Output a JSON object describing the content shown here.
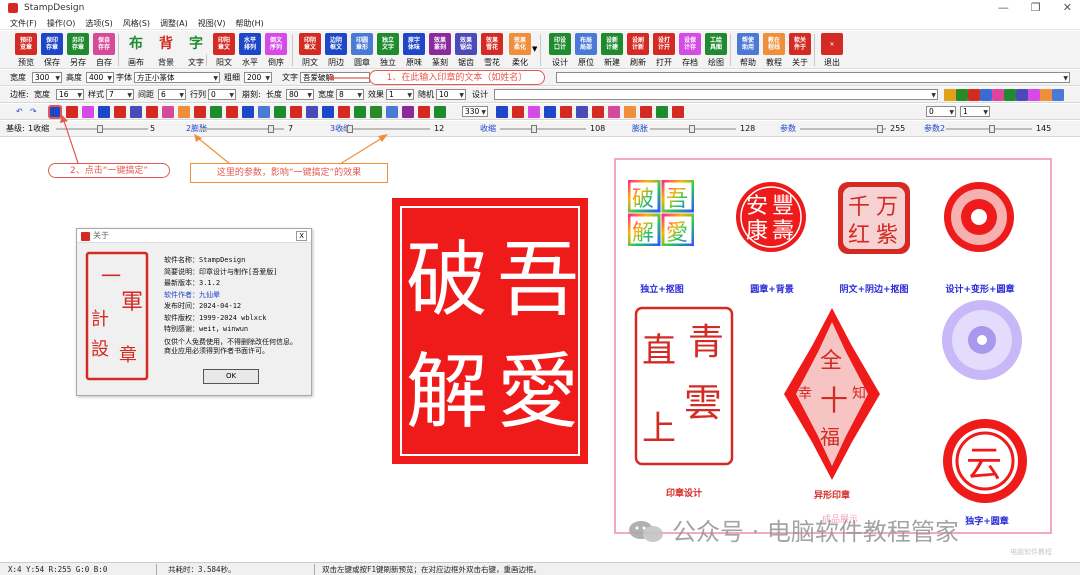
{
  "window": {
    "title": "StampDesign"
  },
  "menu": [
    "文件(F)",
    "操作(O)",
    "选项(S)",
    "风格(S)",
    "调整(A)",
    "视图(V)",
    "帮助(H)"
  ],
  "toolbar": [
    {
      "icon": "预印\n览章",
      "label": "预览",
      "color": "#d42a24"
    },
    {
      "icon": "保印\n存章",
      "label": "保存",
      "color": "#1e46c8"
    },
    {
      "icon": "另印\n存章",
      "label": "另存",
      "color": "#1f8a2e"
    },
    {
      "icon": "保自\n存存",
      "label": "自存",
      "color": "#d64a9c"
    },
    {
      "icon": "布",
      "label": "画布",
      "color": "#f3f3f3"
    },
    {
      "icon": "背",
      "label": "背景",
      "color": "#f3f3f3"
    },
    {
      "icon": "字",
      "label": "文字",
      "color": "#f3f3f3"
    },
    {
      "icon": "印阳\n章文",
      "label": "阳文",
      "color": "#d42a24"
    },
    {
      "icon": "水平\n排列",
      "label": "水平",
      "color": "#1e46c8"
    },
    {
      "icon": "倒文\n序列",
      "label": "倒序",
      "color": "#d64ae8"
    },
    {
      "icon": "印阴\n章文",
      "label": "阴文",
      "color": "#d42a24"
    },
    {
      "icon": "边阴\n框文",
      "label": "阴边",
      "color": "#1e46c8"
    },
    {
      "icon": "印圆\n章形",
      "label": "圆章",
      "color": "#4a7ad6"
    },
    {
      "icon": "独立\n文字",
      "label": "独立",
      "color": "#1f8a2e"
    },
    {
      "icon": "原字\n体味",
      "label": "原味",
      "color": "#1e46c8"
    },
    {
      "icon": "效果\n篆刻",
      "label": "篆刻",
      "color": "#8a2a9c"
    },
    {
      "icon": "效果\n锯齿",
      "label": "锯齿",
      "color": "#4a4ab8"
    },
    {
      "icon": "效果\n雪花",
      "label": "雪花",
      "color": "#d42a24"
    },
    {
      "icon": "效果\n柔化",
      "label": "柔化",
      "color": "#ef8f3c"
    },
    {
      "icon": "印设\n口计",
      "label": "设计",
      "color": "#1f8a2e"
    },
    {
      "icon": "布局\n局部",
      "label": "原位",
      "color": "#4a7ad6"
    },
    {
      "icon": "设新\n计建",
      "label": "新建",
      "color": "#1f8a2e"
    },
    {
      "icon": "设刷\n计新",
      "label": "刷新",
      "color": "#d42a24"
    },
    {
      "icon": "设打\n计开",
      "label": "打开",
      "color": "#d42a24"
    },
    {
      "icon": "设保\n计存",
      "label": "存档",
      "color": "#d64ae8"
    },
    {
      "icon": "工绘\n具图",
      "label": "绘图",
      "color": "#1f8a2e"
    },
    {
      "icon": "帮使\n助用",
      "label": "帮助",
      "color": "#4a7ad6"
    },
    {
      "icon": "教在\n程线",
      "label": "教程",
      "color": "#ef8f3c"
    },
    {
      "icon": "软关\n件于",
      "label": "关于",
      "color": "#d42a24"
    },
    {
      "icon": "✕",
      "label": "退出",
      "color": "#d42a24"
    }
  ],
  "row1": {
    "width_label": "宽度",
    "width_value": "300",
    "height_label": "高度",
    "height_value": "400",
    "font_label": "字体",
    "font_value": "方正小篆体",
    "weight_label": "粗细",
    "weight_value": "200",
    "text_label": "文字",
    "text_value": "吾爱破解"
  },
  "row2": {
    "border_label": "边框:",
    "bw_label": "宽度",
    "bw_value": "16",
    "style_label": "样式",
    "style_value": "7",
    "gap_label": "间距",
    "gap_value": "6",
    "rowspace_label": "行列",
    "rowspace_value": "0",
    "notch_label": "崩刻:",
    "len_label": "长度",
    "len_value": "80",
    "nw_label": "宽度",
    "nw_value": "8",
    "effect_label": "效果",
    "effect_value": "1",
    "rand_label": "随机",
    "rand_value": "10",
    "design_label": "设计"
  },
  "row3": {
    "angle_value": "330",
    "zero1": "0",
    "zero2": "1"
  },
  "row4": [
    {
      "label": "基级:",
      "sub": "1收缩",
      "value": "5"
    },
    {
      "label": "2膨胀",
      "value": "7"
    },
    {
      "label": "3收缩",
      "value": "12"
    },
    {
      "label": "收缩",
      "value": "108"
    },
    {
      "label": "膨胀",
      "value": "128"
    },
    {
      "label": "参数",
      "value": "255"
    },
    {
      "label": "参数2",
      "value": "145"
    }
  ],
  "annotations": {
    "step1": "1、在此输入印章的文本（如姓名）",
    "step2": "2、点击“一键搞定”",
    "params": "这里的参数，影响“一键搞定”的效果"
  },
  "about": {
    "title": "关于",
    "lines": [
      "软件名称：StampDesign",
      "简要说明：印章设计与制作[吾爱版]",
      "最新版本：3.1.2",
      "软件作者：九仙晕",
      "发布时间：2024-04-12",
      "软件版权：1999-2024 wblxck",
      "特别感谢：weit，winwun",
      "仅供个人免费使用，不得删除改任何信息。",
      "商业应用必须得到作者书面许可。"
    ],
    "author_value": "九仙晕",
    "ok_label": "OK",
    "seal_chars": [
      "一",
      "軍",
      "印",
      "計",
      "設",
      "章"
    ]
  },
  "main_seal": {
    "chars": [
      "吾",
      "愛",
      "破",
      "解"
    ]
  },
  "gallery": {
    "captions": [
      "独立+抠图",
      "圆章+背景",
      "阴文+阴边+抠图",
      "设计+变形+圆章",
      "印章设计",
      "异形印章",
      "独字+圆章"
    ],
    "seal1": [
      "吾",
      "愛",
      "破",
      "解"
    ],
    "seal2": [
      "安",
      "豐",
      "康",
      "壽"
    ],
    "seal3": [
      "千",
      "万",
      "红",
      "紫"
    ],
    "seal5": [
      "青",
      "雲",
      "直",
      "上"
    ],
    "seal6": [
      "全",
      "十",
      "幸",
      "福",
      "知",
      "足"
    ],
    "seal8": [
      "云"
    ],
    "faint_caption": "成品展示"
  },
  "status": {
    "coords": "X:4 Y:54 R:255 G:0 B:0",
    "elapsed": "共耗时：3.584秒。",
    "hint": "双击左键或按F1键刷新预览；在对应边框外双击右键，重画边框。"
  },
  "watermark": {
    "text": "公众号 · 电脑软件教程管家",
    "corner": "电脑软件教程"
  }
}
